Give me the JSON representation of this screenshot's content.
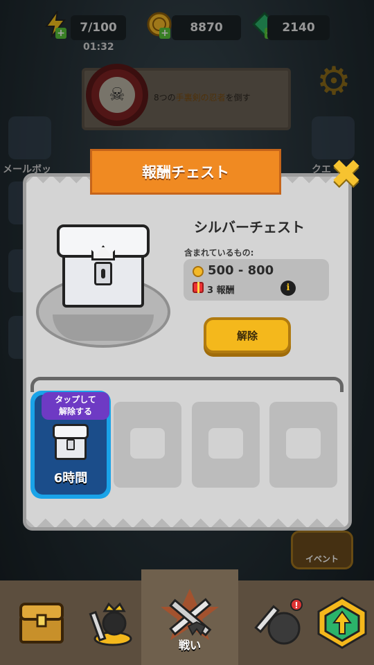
{
  "resources": {
    "energy": "7/100",
    "energy_timer": "01:32",
    "coins": "8870",
    "gems": "2140"
  },
  "quest": {
    "prefix": "8つの",
    "highlight": "手裏剣の忍者",
    "suffix": "を倒す"
  },
  "side_labels": {
    "mail": "メールボッ",
    "quest": "クエ"
  },
  "modal": {
    "title": "報酬チェスト",
    "chest_name": "シルバーチェスト",
    "contains_label": "含まれているもの:",
    "coin_range": "500 - 800",
    "rewards": "3 報酬",
    "unlock_button": "解除"
  },
  "slots": {
    "active": {
      "badge": "タップして\n解除する",
      "time": "6時間"
    }
  },
  "nav": {
    "battle_label": "戦い",
    "event_label": "イベント"
  },
  "colors": {
    "ribbon": "#f08a22",
    "unlock_button": "#f4b81c",
    "active_slot_border": "#1aa3e8",
    "tap_badge": "#6e3ac4"
  }
}
